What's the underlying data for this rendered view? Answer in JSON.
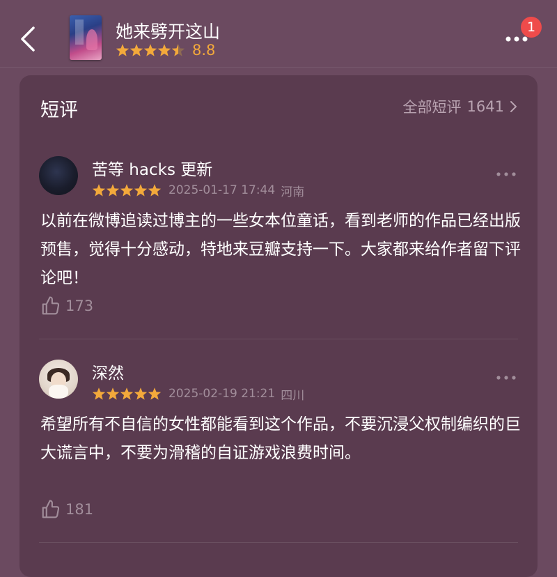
{
  "header": {
    "back_icon": "chevron-left-icon",
    "book_title": "她来劈开这山",
    "rating_stars": 4.5,
    "rating_score": "8.8",
    "more_icon": "more-horizontal-icon",
    "notification_badge": "1"
  },
  "section": {
    "title": "短评",
    "all_label": "全部短评",
    "all_count": "1641",
    "chevron_icon": "chevron-right-icon"
  },
  "reviews": [
    {
      "user": "苦等 hacks 更新",
      "stars": 5,
      "date": "2025-01-17 17:44",
      "location": "河南",
      "text": "以前在微博追读过博主的一些女本位童话，看到老师的作品已经出版预售，觉得十分感动，特地来豆瓣支持一下。大家都来给作者留下评论吧！",
      "likes": "173"
    },
    {
      "user": "深然",
      "stars": 5,
      "date": "2025-02-19 21:21",
      "location": "四川",
      "text": "希望所有不自信的女性都能看到这个作品，不要沉浸父权制编织的巨大谎言中，不要为滑稽的自证游戏浪费时间。",
      "likes": "181"
    }
  ],
  "colors": {
    "background": "#6b4a60",
    "card": "#5a3b4f",
    "star": "#f3a93b",
    "muted_text": "#a28e9b",
    "badge": "#ef4b4b"
  }
}
